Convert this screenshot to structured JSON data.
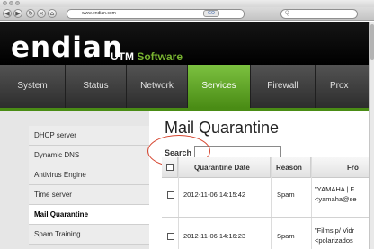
{
  "browser": {
    "url": "www.endian.com",
    "url_go": "GO",
    "search_placeholder": "Q"
  },
  "header": {
    "logo": "endian",
    "product_prefix": "UTM ",
    "product_accent": "Software"
  },
  "nav": {
    "tabs": [
      "System",
      "Status",
      "Network",
      "Services",
      "Firewall",
      "Prox"
    ],
    "active": "Services"
  },
  "sidebar": {
    "items": [
      "DHCP server",
      "Dynamic DNS",
      "Antivirus Engine",
      "Time server",
      "Mail Quarantine",
      "Spam Training"
    ],
    "active": "Mail Quarantine"
  },
  "main": {
    "title": "Mail Quarantine",
    "search_label": "Search",
    "search_value": "",
    "table": {
      "headers": [
        "Quarantine Date",
        "Reason",
        "Fro"
      ],
      "rows": [
        {
          "date": "2012-11-06 14:15:42",
          "reason": "Spam",
          "from_line1": "\"YAMAHA | F",
          "from_line2": "<yamaha@se"
        },
        {
          "date": "2012-11-06 14:16:23",
          "reason": "Spam",
          "from_line1": "\"Films p/ Vidr",
          "from_line2": "<polarizados"
        }
      ]
    }
  },
  "colors": {
    "accent_green": "#79b531",
    "annotation_red": "#d6452f"
  }
}
